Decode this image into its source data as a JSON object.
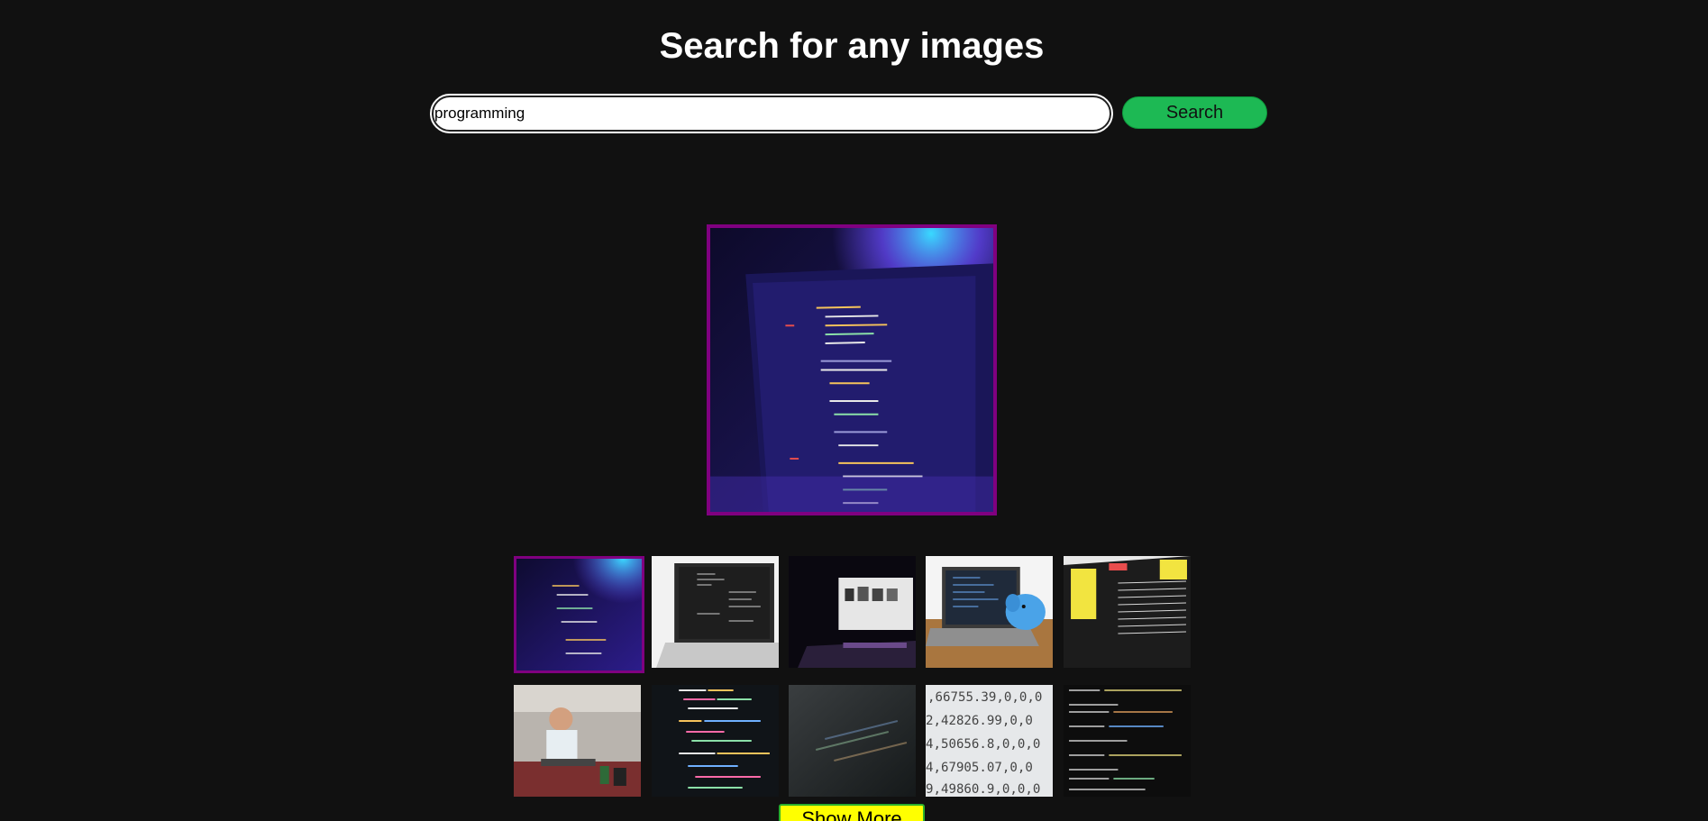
{
  "header": {
    "title": "Search for any images"
  },
  "search": {
    "value": "programming",
    "button_label": "Search"
  },
  "gallery": {
    "selected_index": 0,
    "thumbnails": [
      {
        "subject": "laptop code purple light"
      },
      {
        "subject": "white laptop code editor"
      },
      {
        "subject": "dark desk monitor"
      },
      {
        "subject": "macbook with blue toy elephant"
      },
      {
        "subject": "laptop terminal output"
      },
      {
        "subject": "man working at laptop in office"
      },
      {
        "subject": "colorful code on screen"
      },
      {
        "subject": "blurred dark code"
      },
      {
        "subject": "printed numbers close-up"
      },
      {
        "subject": "terminal code lines"
      }
    ]
  },
  "footer": {
    "show_more_label": "Show More"
  },
  "colors": {
    "background": "#111111",
    "selected_border": "#800080",
    "search_button": "#1db954",
    "show_more": "#ffff00"
  }
}
